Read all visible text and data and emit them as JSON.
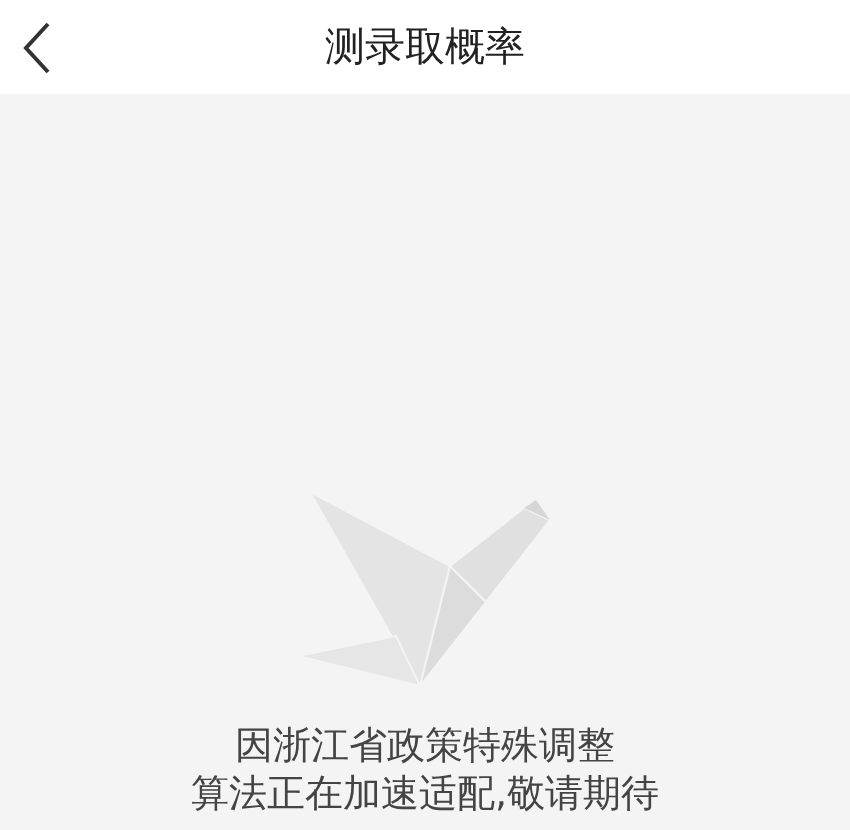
{
  "header": {
    "title": "测录取概率"
  },
  "empty_state": {
    "lines": [
      "因浙江省政策特殊调整",
      "算法正在加速适配,敬请期待"
    ]
  }
}
